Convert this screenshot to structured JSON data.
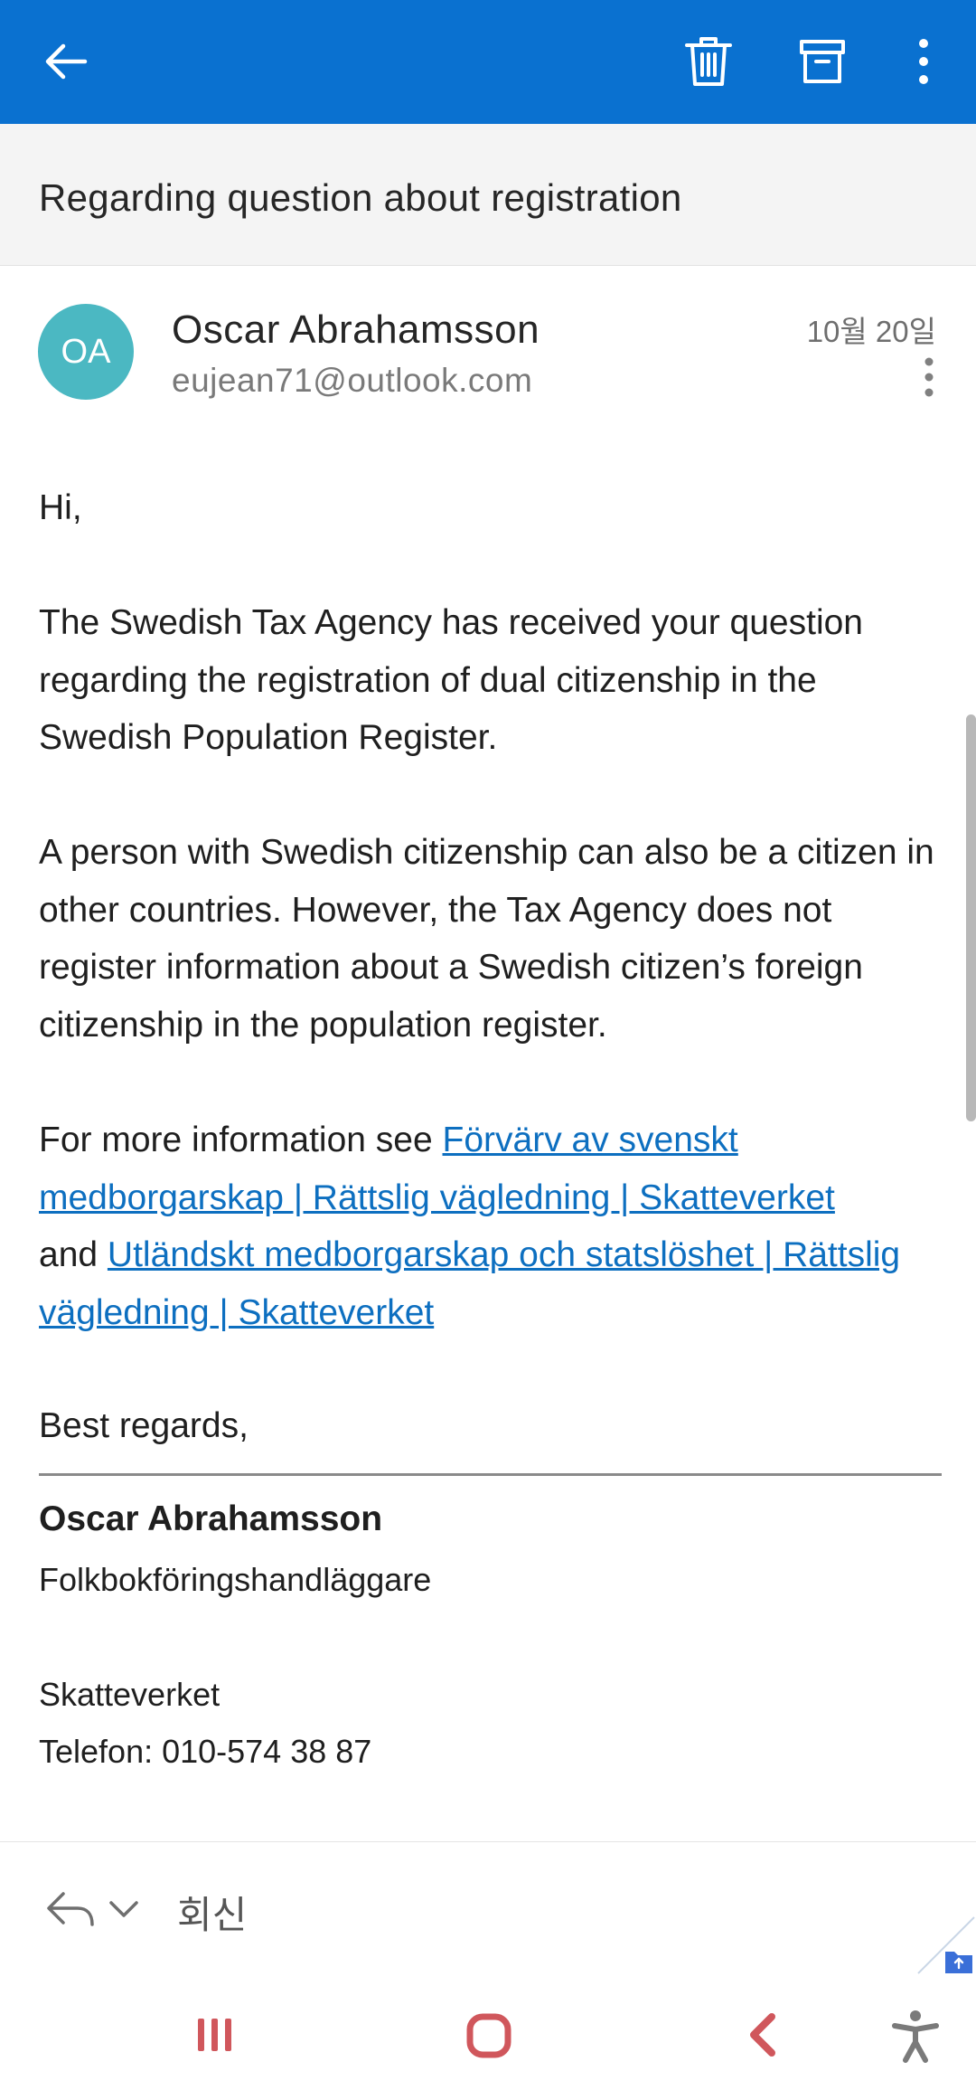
{
  "appbar": {
    "background": "#0a71d0",
    "icons": [
      "back-arrow-icon",
      "trash-icon",
      "archive-icon",
      "more-vertical-icon"
    ]
  },
  "email": {
    "subject": "Regarding question about registration",
    "sender": {
      "initials": "OA",
      "name": "Oscar Abrahamsson",
      "email": "eujean71@outlook.com",
      "avatar_color": "#4bb8c2"
    },
    "date": "10월 20일",
    "body": {
      "greeting": "Hi,",
      "para1": "The Swedish Tax Agency has received your question regarding the registration of dual citizenship in the Swedish Population Register.",
      "para2": "A person with Swedish citizenship can also be a citizen in other countries. However, the Tax Agency does not register information about a Swedish citizen’s foreign citizenship in the population register.",
      "para3_prefix": "For more information see ",
      "link1": "Förvärv av svenskt medborgarskap | Rättslig vägledning | Skatteverket",
      "para3_middle": "and ",
      "link2": "Utländskt medborgarskap och statslöshet | Rättslig vägledning | Skatteverket",
      "closing": "Best regards,",
      "link_color": "#0d6fc0"
    },
    "signature": {
      "name": "Oscar Abrahamsson",
      "title": "Folkbokföringshandläggare",
      "org": "Skatteverket",
      "phone": "Telefon: 010-574 38 87"
    }
  },
  "reply_bar": {
    "label": "회신",
    "icons": [
      "reply-icon",
      "chevron-down-icon"
    ]
  },
  "navbar": {
    "icons": [
      "recent-apps-icon",
      "home-icon",
      "back-icon",
      "accessibility-icon"
    ]
  }
}
